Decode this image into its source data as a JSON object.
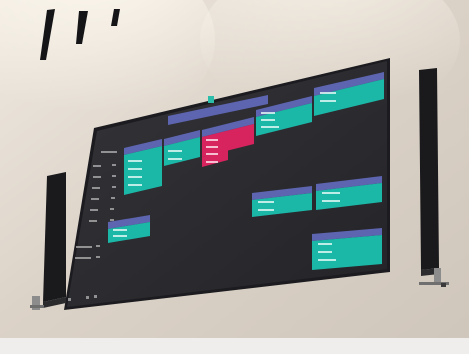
{
  "scene": {
    "subject": "wall-display",
    "colors": {
      "wall": "#d8d0c6",
      "bezel": "#1e1e22",
      "screen": "#2a2a2e",
      "header_bar": "#5d64b0",
      "card_teal": "#1bb8a8",
      "card_pink": "#d8245e",
      "sidebar_text": "#c8c8c8",
      "speaker": "#1a1a1c",
      "bracket": "#8c8c8c"
    },
    "icons": [
      "track-light-icon",
      "speaker-icon"
    ]
  }
}
